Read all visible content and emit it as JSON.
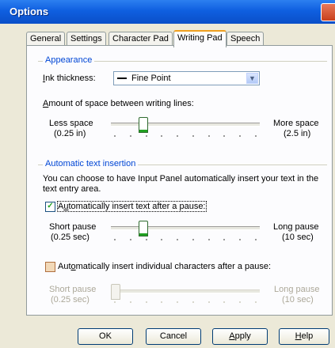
{
  "window": {
    "title": "Options"
  },
  "tabs": [
    {
      "label": "General"
    },
    {
      "label": "Settings"
    },
    {
      "label": "Character Pad"
    },
    {
      "label": "Writing Pad"
    },
    {
      "label": "Speech"
    }
  ],
  "appearance": {
    "group_title": "Appearance",
    "ink_label_i": "I",
    "ink_label_rest": "nk thickness:",
    "ink_value": "Fine Point",
    "space_label_a": "A",
    "space_label_rest": "mount of space between writing lines:",
    "less_space": "Less space",
    "less_space_val": "(0.25 in)",
    "more_space": "More space",
    "more_space_val": "(2.5 in)",
    "slider_level": 0.2
  },
  "auto_insert": {
    "group_title": "Automatic text insertion",
    "description_line1": "You can choose to have Input Panel automatically insert your text in the",
    "description_line2": "text entry area.",
    "check1_pre": "A",
    "check1_u": "u",
    "check1_post": "tomatically insert text after a pause:",
    "check1_checked": true,
    "short_pause": "Short pause",
    "short_pause_val": "(0.25 sec)",
    "long_pause": "Long pause",
    "long_pause_val": "(10 sec)",
    "pause_level": 0.2,
    "check2_pre": "Aut",
    "check2_u": "o",
    "check2_post": "matically insert individual characters after a pause:",
    "check2_checked": false,
    "short_pause2": "Short pause",
    "short_pause2_val": "(0.25 sec)",
    "long_pause2": "Long pause",
    "long_pause2_val": "(10 sec)"
  },
  "buttons": {
    "ok": "OK",
    "cancel": "Cancel",
    "apply_u": "A",
    "apply_rest": "pply",
    "help_u": "H",
    "help_rest": "elp"
  },
  "colors": {
    "titlebar": "#0f5fe0",
    "group_title": "#0046d5",
    "active_tab_accent": "#f0a020",
    "slider_thumb": "#21a121"
  }
}
